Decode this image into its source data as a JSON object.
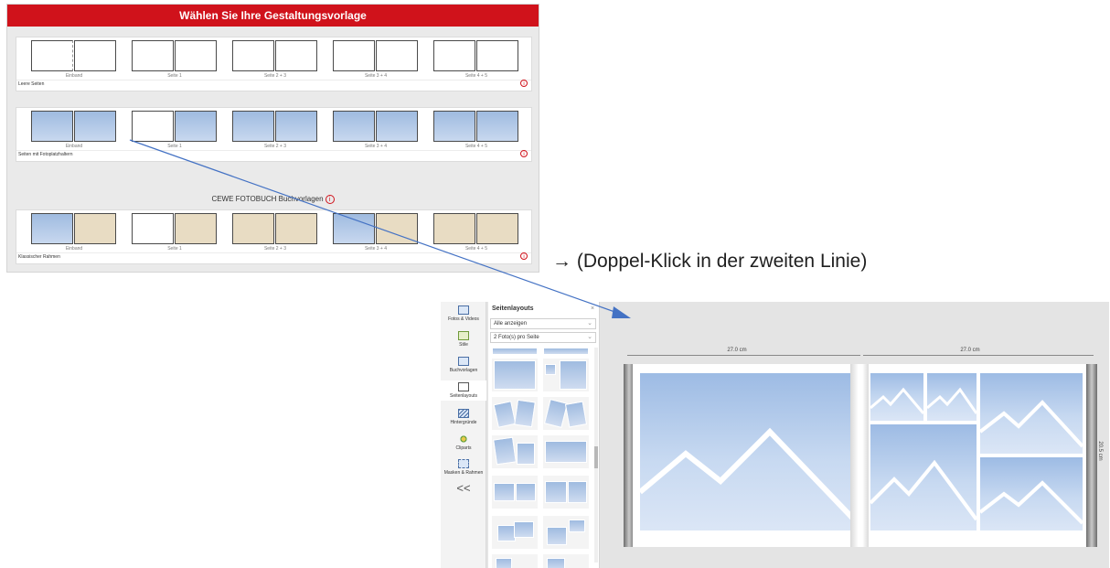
{
  "chooser": {
    "title": "Wählen Sie Ihre Gestaltungsvorlage",
    "rows": [
      {
        "label": "Leere Seiten",
        "captions": [
          "Einband",
          "Seite 1",
          "Seite 2 + 3",
          "Seite 3 + 4",
          "Seite 4 + 5"
        ]
      },
      {
        "label": "Seiten mit Fotoplatzhaltern",
        "captions": [
          "Einband",
          "Seite 1",
          "Seite 2 + 3",
          "Seite 3 + 4",
          "Seite 4 + 5"
        ]
      },
      {
        "label": "Klassischer Rahmen",
        "captions": [
          "Einband",
          "Seite 1",
          "Seite 2 + 3",
          "Seite 3 + 4",
          "Seite 4 + 5"
        ]
      }
    ],
    "cewe_title": "CEWE FOTOBUCH Buchvorlagen",
    "info_glyph": "i"
  },
  "hint": "→ (Doppel-Klick in der zweiten Linie)",
  "editor": {
    "nav": [
      {
        "label": "Fotos & Videos",
        "icon": "photos-icon"
      },
      {
        "label": "Stile",
        "icon": "styles-icon"
      },
      {
        "label": "Buchvorlagen",
        "icon": "book-templates-icon"
      },
      {
        "label": "Seitenlayouts",
        "icon": "page-layouts-icon"
      },
      {
        "label": "Hintergründe",
        "icon": "backgrounds-icon"
      },
      {
        "label": "Cliparts",
        "icon": "cliparts-icon"
      },
      {
        "label": "Masken & Rahmen",
        "icon": "masks-frames-icon"
      }
    ],
    "collapse_glyph": "<<",
    "panel": {
      "title": "Seitenlayouts",
      "close_glyph": "×",
      "filter_all": "Alle anzeigen",
      "filter_photos": "2 Foto(s) pro Seite"
    },
    "canvas": {
      "width_left": "27.0 cm",
      "width_right": "27.0 cm",
      "height": "20.5 cm"
    }
  },
  "colors": {
    "brand_red": "#d0121b",
    "photo_blue": "#a9c3e6",
    "arrow": "#4472c4"
  }
}
